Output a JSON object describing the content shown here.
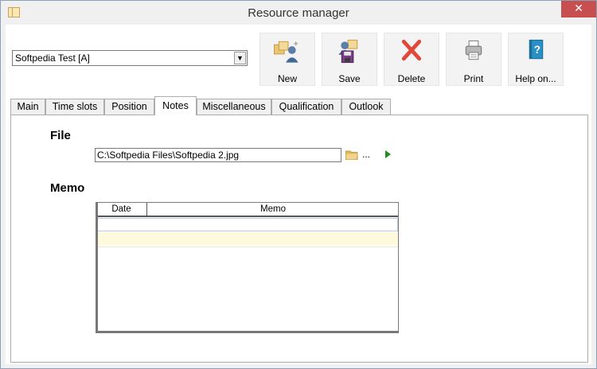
{
  "window": {
    "title": "Resource manager",
    "close_glyph": "✕"
  },
  "resource_select": {
    "value": "Softpedia Test [A]",
    "arrow_glyph": "▼"
  },
  "toolbar": [
    {
      "name": "new-button",
      "label": "New",
      "icon": "new-user-icon"
    },
    {
      "name": "save-button",
      "label": "Save",
      "icon": "save-icon"
    },
    {
      "name": "delete-button",
      "label": "Delete",
      "icon": "delete-icon"
    },
    {
      "name": "print-button",
      "label": "Print",
      "icon": "printer-icon"
    },
    {
      "name": "help-button",
      "label": "Help on...",
      "icon": "help-book-icon"
    }
  ],
  "tabs": [
    {
      "label": "Main"
    },
    {
      "label": "Time slots"
    },
    {
      "label": "Position"
    },
    {
      "label": "Notes",
      "active": true
    },
    {
      "label": "Miscellaneous"
    },
    {
      "label": "Qualification"
    },
    {
      "label": "Outlook"
    }
  ],
  "notes": {
    "file_title": "File",
    "file_path": "C:\\Softpedia Files\\Softpedia 2.jpg",
    "browse_dots": "...",
    "memo_title": "Memo",
    "grid": {
      "columns": [
        "Date",
        "Memo"
      ],
      "rows": []
    }
  },
  "colors": {
    "delete_red": "#e0483a",
    "play_green": "#1c8f1c",
    "close_red": "#c74f4f",
    "alt_row": "#fdf9dc"
  }
}
